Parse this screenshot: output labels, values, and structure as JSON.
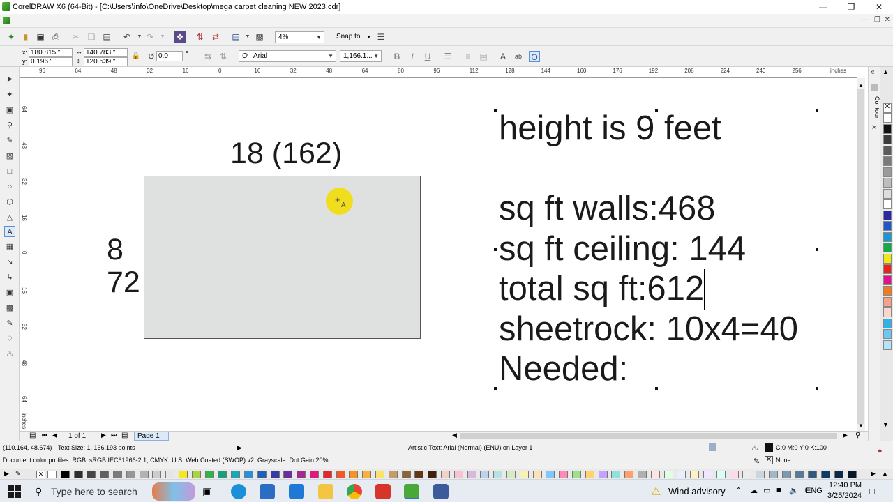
{
  "window": {
    "title": "CorelDRAW X6 (64-Bit) - [C:\\Users\\info\\OneDrive\\Desktop\\mega carpet cleaning NEW 2023.cdr]",
    "minimize": "—",
    "maximize": "❐",
    "close": "✕"
  },
  "standard_toolbar": {
    "zoom_level": "4%",
    "snap_to": "Snap to"
  },
  "property_bar": {
    "x_label": "x:",
    "x_value": "180.815 \"",
    "y_label": "y:",
    "y_value": "0.196 \"",
    "width_value": "140.783 \"",
    "height_value": "120.539 \"",
    "rotation_value": "0.0",
    "rotation_unit": "°",
    "font_name": "Arial",
    "font_size": "1,166.1..."
  },
  "ruler_top": {
    "ticks": [
      "96",
      "64",
      "48",
      "32",
      "16",
      "0",
      "16",
      "32",
      "48",
      "64",
      "80",
      "96",
      "112",
      "128",
      "144",
      "160",
      "176",
      "192",
      "208",
      "224",
      "240",
      "256"
    ],
    "unit": "inches"
  },
  "ruler_left": {
    "ticks": [
      "64",
      "48",
      "32",
      "16",
      "0",
      "16",
      "32",
      "48",
      "64"
    ],
    "unit": "inches"
  },
  "canvas": {
    "rect_top_label": "18 (162)",
    "rect_left_label_1": "8",
    "rect_left_label_2": "72",
    "text_lines": [
      "height is 9 feet",
      "",
      "sq ft walls:468",
      "sq ft ceiling: 144",
      "total sq ft:612",
      "sheetrock: 10x4=40",
      "Needed:"
    ],
    "cursor_letter": "A"
  },
  "docker": {
    "contour_label": "Contour"
  },
  "page_nav": {
    "page_count": "1 of 1",
    "page_tab": "Page 1"
  },
  "status": {
    "cursor_coords": "(110.164, 48.674)",
    "text_size": "Text Size: 1, 166.193 points",
    "object_info": "Artistic Text: Arial (Normal) (ENU) on Layer 1",
    "color_profiles": "Document color profiles: RGB: sRGB IEC61966-2.1; CMYK: U.S. Web Coated (SWOP) v2; Grayscale: Dot Gain 20%",
    "fill_value": "C:0 M:0 Y:0 K:100",
    "outline_value": "None"
  },
  "colors": {
    "vertical_palette": [
      "#ffffff",
      "#111111",
      "#3a3a3a",
      "#5a5a5a",
      "#7a7a7a",
      "#9a9a9a",
      "#bdbdbd",
      "#dddddd",
      "#ffffff",
      "#2a2aa0",
      "#1f56c8",
      "#1a96d8",
      "#13a84a",
      "#f0e61a",
      "#e8231f",
      "#e2108a",
      "#f07c1c",
      "#f5a28a",
      "#fbd6cc",
      "#2db3e8",
      "#6ec7f0",
      "#b5e2f8"
    ],
    "horizontal_palette": [
      "#ffffff",
      "#000000",
      "#2d2d2d",
      "#454545",
      "#606060",
      "#7b7b7b",
      "#969696",
      "#b2b2b2",
      "#cccccc",
      "#e5e5e5",
      "#f8e71c",
      "#a8d63b",
      "#2fb34a",
      "#1b9e7a",
      "#17a9b6",
      "#2c8fd6",
      "#2360b5",
      "#3a3ba0",
      "#6a2f9a",
      "#a32a8c",
      "#e0197f",
      "#e8232a",
      "#f15a24",
      "#f7931e",
      "#fbb03b",
      "#fde26a",
      "#c69c6d",
      "#8c6239",
      "#603813",
      "#42210b",
      "#f4d0c6",
      "#f8c2d4",
      "#d9b8e0",
      "#bbd3ef",
      "#b6e3df",
      "#d4ecc0",
      "#f6f2b3",
      "#fde2b6",
      "#7fc7ff",
      "#ff8ab7",
      "#9be28a",
      "#ffd36e",
      "#c4a2ff",
      "#8fe0e0",
      "#ff9f6b",
      "#b0b0b0",
      "#ffe4e1",
      "#e0ffe0",
      "#e6f0ff",
      "#fff3c4",
      "#f0e6ff",
      "#d9fff8",
      "#ffd9e6",
      "#ececec",
      "#c9d6df",
      "#a3b8c7",
      "#7d99af",
      "#587a97",
      "#335b7f",
      "#0e3c66",
      "#0a2a47",
      "#06172a"
    ],
    "rect_fill": "#dfe1e1",
    "cursor_yellow": "#f2de0a"
  },
  "taskbar": {
    "search_placeholder": "Type here to search",
    "weather": "Wind advisory",
    "language": "ENG",
    "time": "12:40 PM",
    "date": "3/25/2024"
  }
}
